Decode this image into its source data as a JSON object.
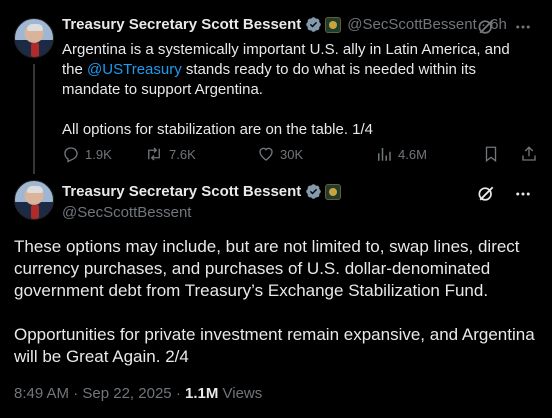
{
  "tweet1": {
    "author_name": "Treasury Secretary Scott Bessent",
    "handle": "@SecScottBessent",
    "separator": "·",
    "time": "6h",
    "text_part1": "Argentina is a systemically important U.S. ally in Latin America, and the ",
    "mention": "@USTreasury",
    "text_part2": " stands ready to do what is needed within its mandate to support Argentina.",
    "text_para2": "All options for stabilization are on the table. 1/4",
    "replies": "1.9K",
    "reposts": "7.6K",
    "likes": "30K",
    "views": "4.6M"
  },
  "tweet2": {
    "author_name": "Treasury Secretary Scott Bessent",
    "handle": "@SecScottBessent",
    "text_para1": "These options may include, but are not limited to, swap lines, direct currency purchases, and purchases of U.S. dollar-denominated government debt from Treasury’s Exchange Stabilization Fund.",
    "text_para2": "Opportunities for private investment remain expansive, and Argentina will be Great Again. 2/4",
    "time": "8:49 AM",
    "date_sep": "·",
    "date": "Sep 22, 2025",
    "meta_sep": "·",
    "views_count": "1.1M",
    "views_label": "Views"
  },
  "icons": {
    "verified": "verified-badge-icon",
    "gov": "government-seal-icon",
    "grok": "grok-icon",
    "more": "more-icon",
    "reply": "reply-icon",
    "repost": "repost-icon",
    "like": "heart-icon",
    "views": "views-icon",
    "bookmark": "bookmark-icon",
    "share": "share-icon"
  },
  "colors": {
    "background": "#000000",
    "text": "#e7e9ea",
    "secondary": "#71767b",
    "link": "#1d9bf0"
  }
}
